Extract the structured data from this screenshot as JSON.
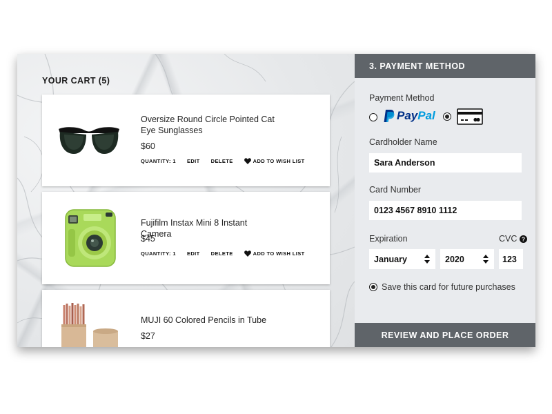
{
  "cart": {
    "title": "YOUR CART (5)",
    "items": [
      {
        "name": "Oversize Round Circle Pointed Cat Eye Sunglasses",
        "price": "$60",
        "quantity": "QUANTITY: 1",
        "edit": "EDIT",
        "delete": "DELETE",
        "wish": "ADD TO WISH LIST"
      },
      {
        "name": "Fujifilm Instax Mini 8 Instant Camera",
        "price": "$45",
        "quantity": "QUANTITY: 1",
        "edit": "EDIT",
        "delete": "DELETE",
        "wish": "ADD TO WISH LIST"
      },
      {
        "name": "MUJI 60 Colored Pencils in Tube",
        "price": "$27"
      }
    ]
  },
  "payment": {
    "header": "3. PAYMENT METHOD",
    "method_label": "Payment Method",
    "paypal_pay": "Pay",
    "paypal_pal": "Pal",
    "selected_method": "card",
    "cardholder_label": "Cardholder Name",
    "cardholder_value": "Sara Anderson",
    "card_number_label": "Card Number",
    "card_number_value": "0123 4567 8910 1112",
    "expiration_label": "Expiration",
    "cvc_label": "CVC",
    "month": "January",
    "year": "2020",
    "cvc_value": "123",
    "save_card": "Save this card for future purchases",
    "save_card_checked": true,
    "place_order": "REVIEW AND PLACE ORDER"
  },
  "colors": {
    "panel_header": "#5f6469",
    "panel_bg": "#e9ebee",
    "paypal_dark": "#003087",
    "paypal_light": "#009cde"
  },
  "icons": [
    "heart-icon",
    "paypal-logo",
    "credit-card-icon",
    "question-icon",
    "select-arrows-icon"
  ]
}
